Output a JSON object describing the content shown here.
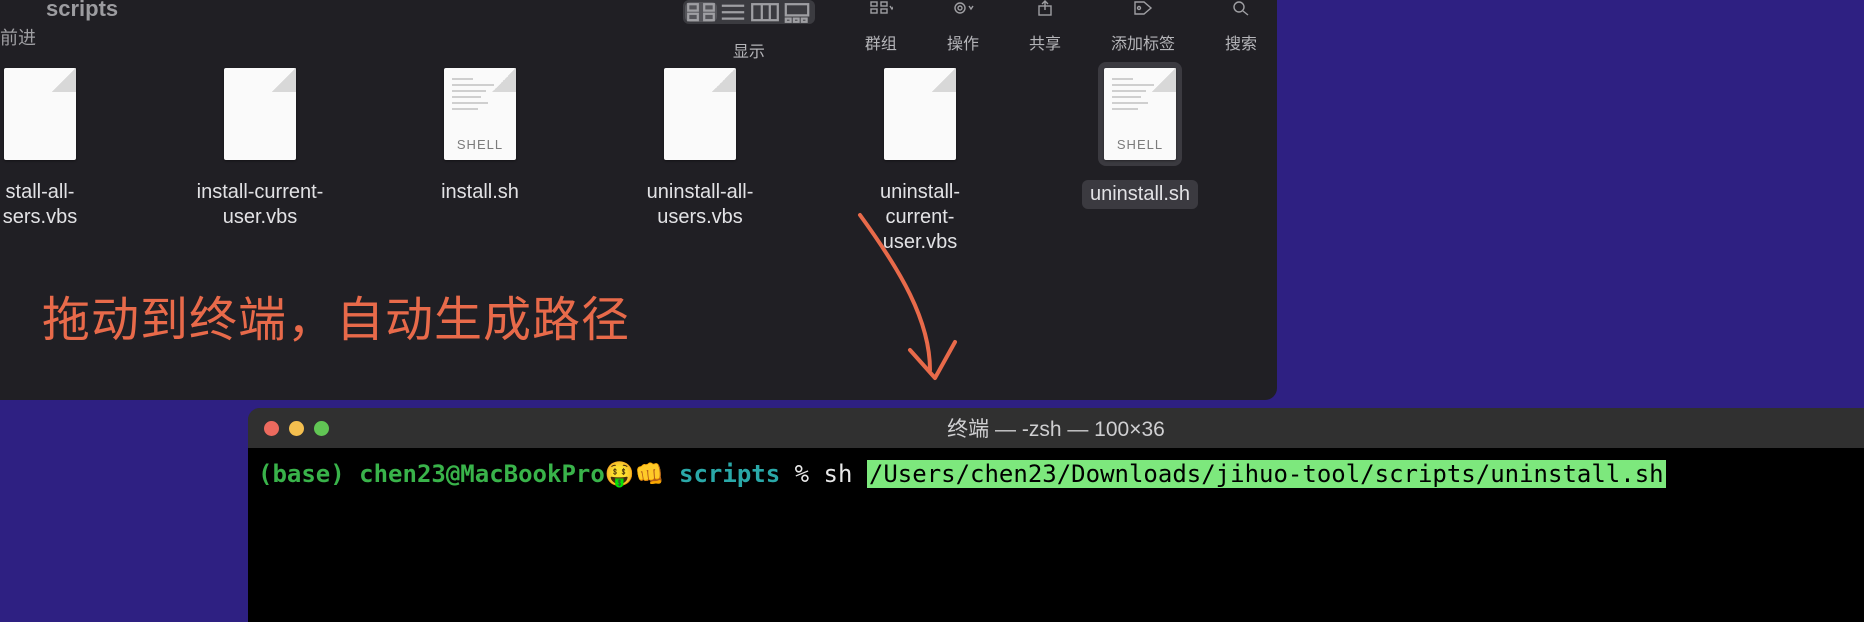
{
  "finder": {
    "title": "scripts",
    "nav_forward": "前进",
    "toolbar": {
      "view_label": "显示",
      "group_label": "群组",
      "action_label": "操作",
      "share_label": "共享",
      "tags_label": "添加标签",
      "search_label": "搜索"
    },
    "files": [
      {
        "name": "stall-all-\nsers.vbs",
        "type": "vbs",
        "selected": false
      },
      {
        "name": "install-current-\nuser.vbs",
        "type": "vbs",
        "selected": false
      },
      {
        "name": "install.sh",
        "type": "shell",
        "selected": false
      },
      {
        "name": "uninstall-all-\nusers.vbs",
        "type": "vbs",
        "selected": false
      },
      {
        "name": "uninstall-current-\nuser.vbs",
        "type": "vbs",
        "selected": false
      },
      {
        "name": "uninstall.sh",
        "type": "shell",
        "selected": true
      }
    ],
    "shell_badge": "SHELL"
  },
  "annotation": "拖动到终端，自动生成路径",
  "terminal": {
    "title": "终端 — -zsh — 100×36",
    "prompt_env": "(base)",
    "prompt_userhost": "chen23@MacBookPro",
    "prompt_emoji": "🤑👊",
    "prompt_cwd": "scripts",
    "prompt_symbol": "%",
    "command": "sh",
    "path_highlighted": "/Users/chen23/Downloads/jihuo-tool/scripts/uninstall.sh"
  }
}
